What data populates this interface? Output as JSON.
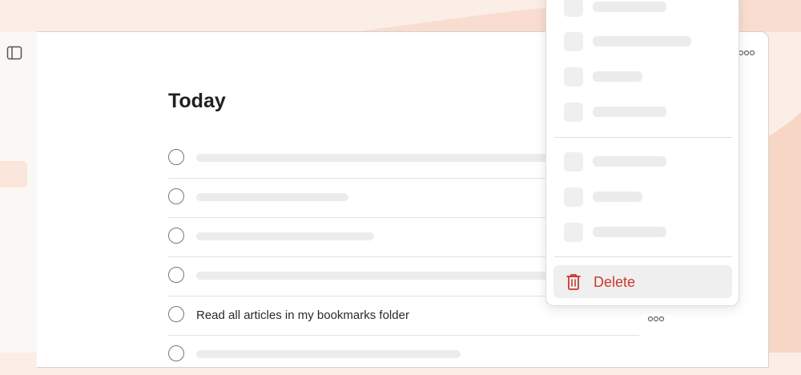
{
  "page": {
    "title": "Today"
  },
  "tasks": [
    {
      "text": "",
      "placeholder_fraction": 0.8
    },
    {
      "text": "",
      "placeholder_fraction": 0.34
    },
    {
      "text": "",
      "placeholder_fraction": 0.4
    },
    {
      "text": "",
      "placeholder_fraction": 0.8
    },
    {
      "text": "Read all articles in my bookmarks folder"
    },
    {
      "text": "",
      "placeholder_fraction": 0.6
    }
  ],
  "context_menu": {
    "delete_label": "Delete"
  },
  "icons": {
    "sidebar_toggle": "sidebar-toggle-icon",
    "more": "more-horizontal-icon",
    "delete": "trash-icon"
  },
  "colors": {
    "accent_background": "#fbeee7",
    "delete_red": "#c9392a",
    "checkbox_border": "#777777"
  }
}
